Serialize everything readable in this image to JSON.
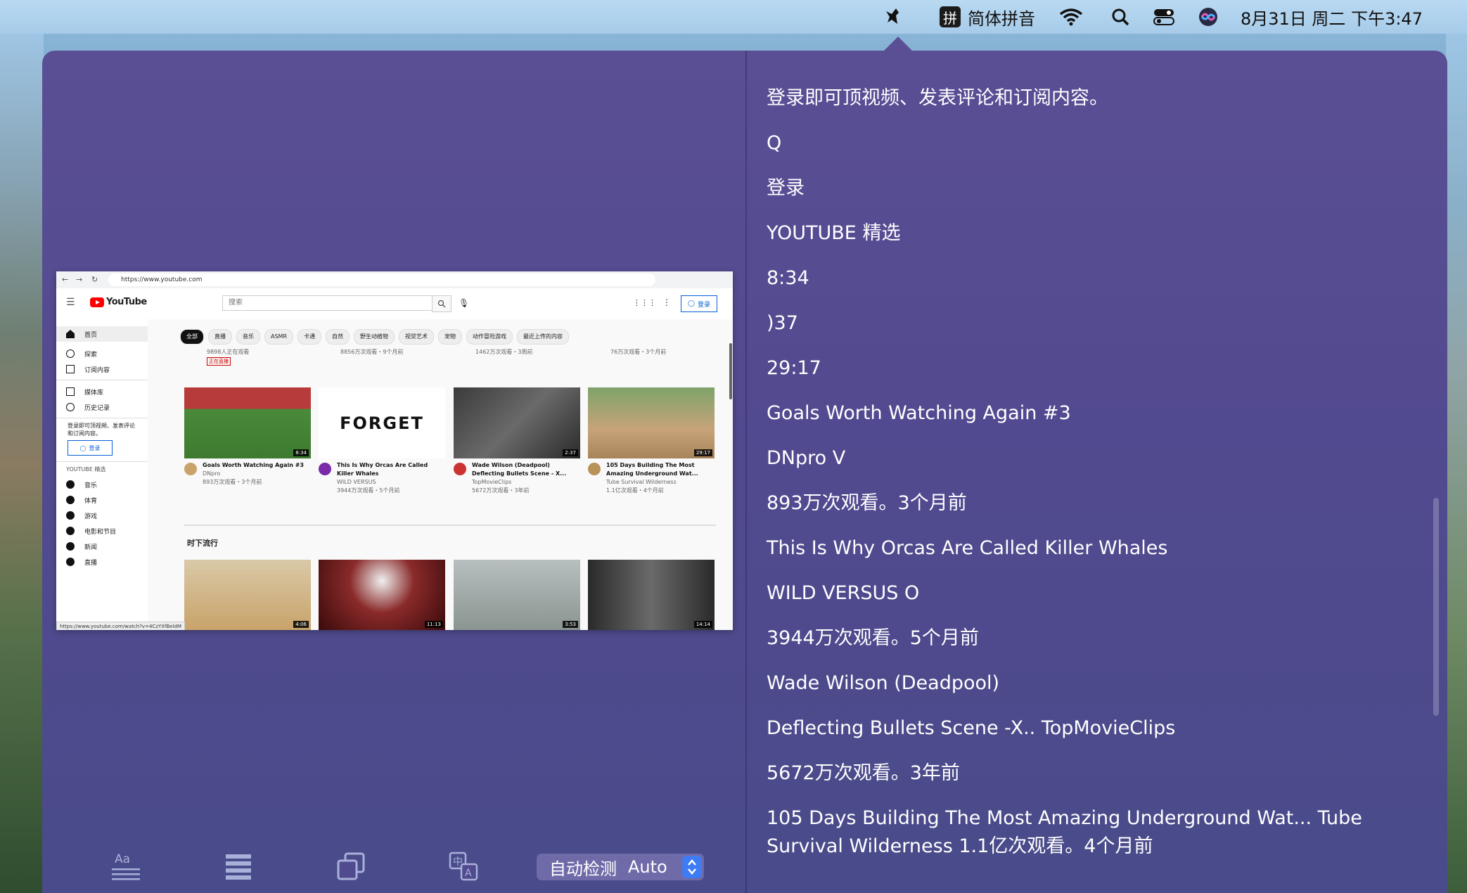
{
  "menubar": {
    "input_method": "简体拼音",
    "input_badge": "拼",
    "datetime": "8月31日 周二 下午3:47"
  },
  "screenshot": {
    "url": "https://www.youtube.com",
    "logo": "YouTube",
    "search_placeholder": "搜索",
    "signin": "登录",
    "sidebar": [
      "首页",
      "探索",
      "订阅内容",
      "媒体库",
      "历史记录"
    ],
    "signin_prompt": "登录即可顶视频、发表评论和订阅内容。",
    "section_title": "YOUTUBE 精选",
    "section_items": [
      "音乐",
      "体育",
      "游戏",
      "电影和节目",
      "新闻",
      "直播"
    ],
    "chips": [
      "全部",
      "直播",
      "音乐",
      "ASMR",
      "卡通",
      "自然",
      "野生动植物",
      "视觉艺术",
      "宠物",
      "动作冒险游戏",
      "最近上传的内容"
    ],
    "top_row_stats": [
      "9898人正在观看",
      "8856万次观看・9个月前",
      "1462万次观看・3周前",
      "76万次观看・3个月前"
    ],
    "live_badge": "正在直播",
    "videos": [
      {
        "title": "Goals Worth Watching Again #3",
        "channel": "DNpro",
        "stats": "893万次观看・3个月前",
        "duration": "8:34"
      },
      {
        "title": "This Is Why Orcas Are Called Killer Whales",
        "channel": "WILD VERSUS",
        "stats": "3944万次观看・5个月前",
        "duration": "",
        "thumb_text": "FORGET"
      },
      {
        "title": "Wade Wilson (Deadpool) Deflecting Bullets Scene - X...",
        "channel": "TopMovieClips",
        "stats": "5672万次观看・3年前",
        "duration": "2:37"
      },
      {
        "title": "105 Days Building The Most Amazing Underground Wat...",
        "channel": "Tube Survival Wilderness",
        "stats": "1.1亿次观看・4个月前",
        "duration": "29:17"
      }
    ],
    "trending_title": "时下流行",
    "trending_durations": [
      "4:06",
      "11:13",
      "3:53",
      "14:14"
    ],
    "status_url": "https://www.youtube.com/watch?v=4CzYXfBeldM"
  },
  "toolbar": {
    "lang_cn": "自动检测",
    "lang_en": "Auto"
  },
  "ocr_lines": [
    "登录即可顶视频、发表评论和订阅内容。",
    "Q",
    "登录",
    "YOUTUBE 精选",
    "8:34",
    ")37",
    "29:17",
    "Goals Worth Watching Again #3",
    "DNpro V",
    "893万次观看。3个月前",
    "This Is Why Orcas Are Called Killer Whales",
    "WILD VERSUS O",
    "3944万次观看。5个月前",
    "Wade Wilson (Deadpool)",
    "Deflecting Bullets Scene -X.. TopMovieClips",
    "5672万次观看。3年前",
    "105 Days Building The Most Amazing Underground Wat... Tube Survival Wilderness 1.1亿次观看。4个月前"
  ]
}
